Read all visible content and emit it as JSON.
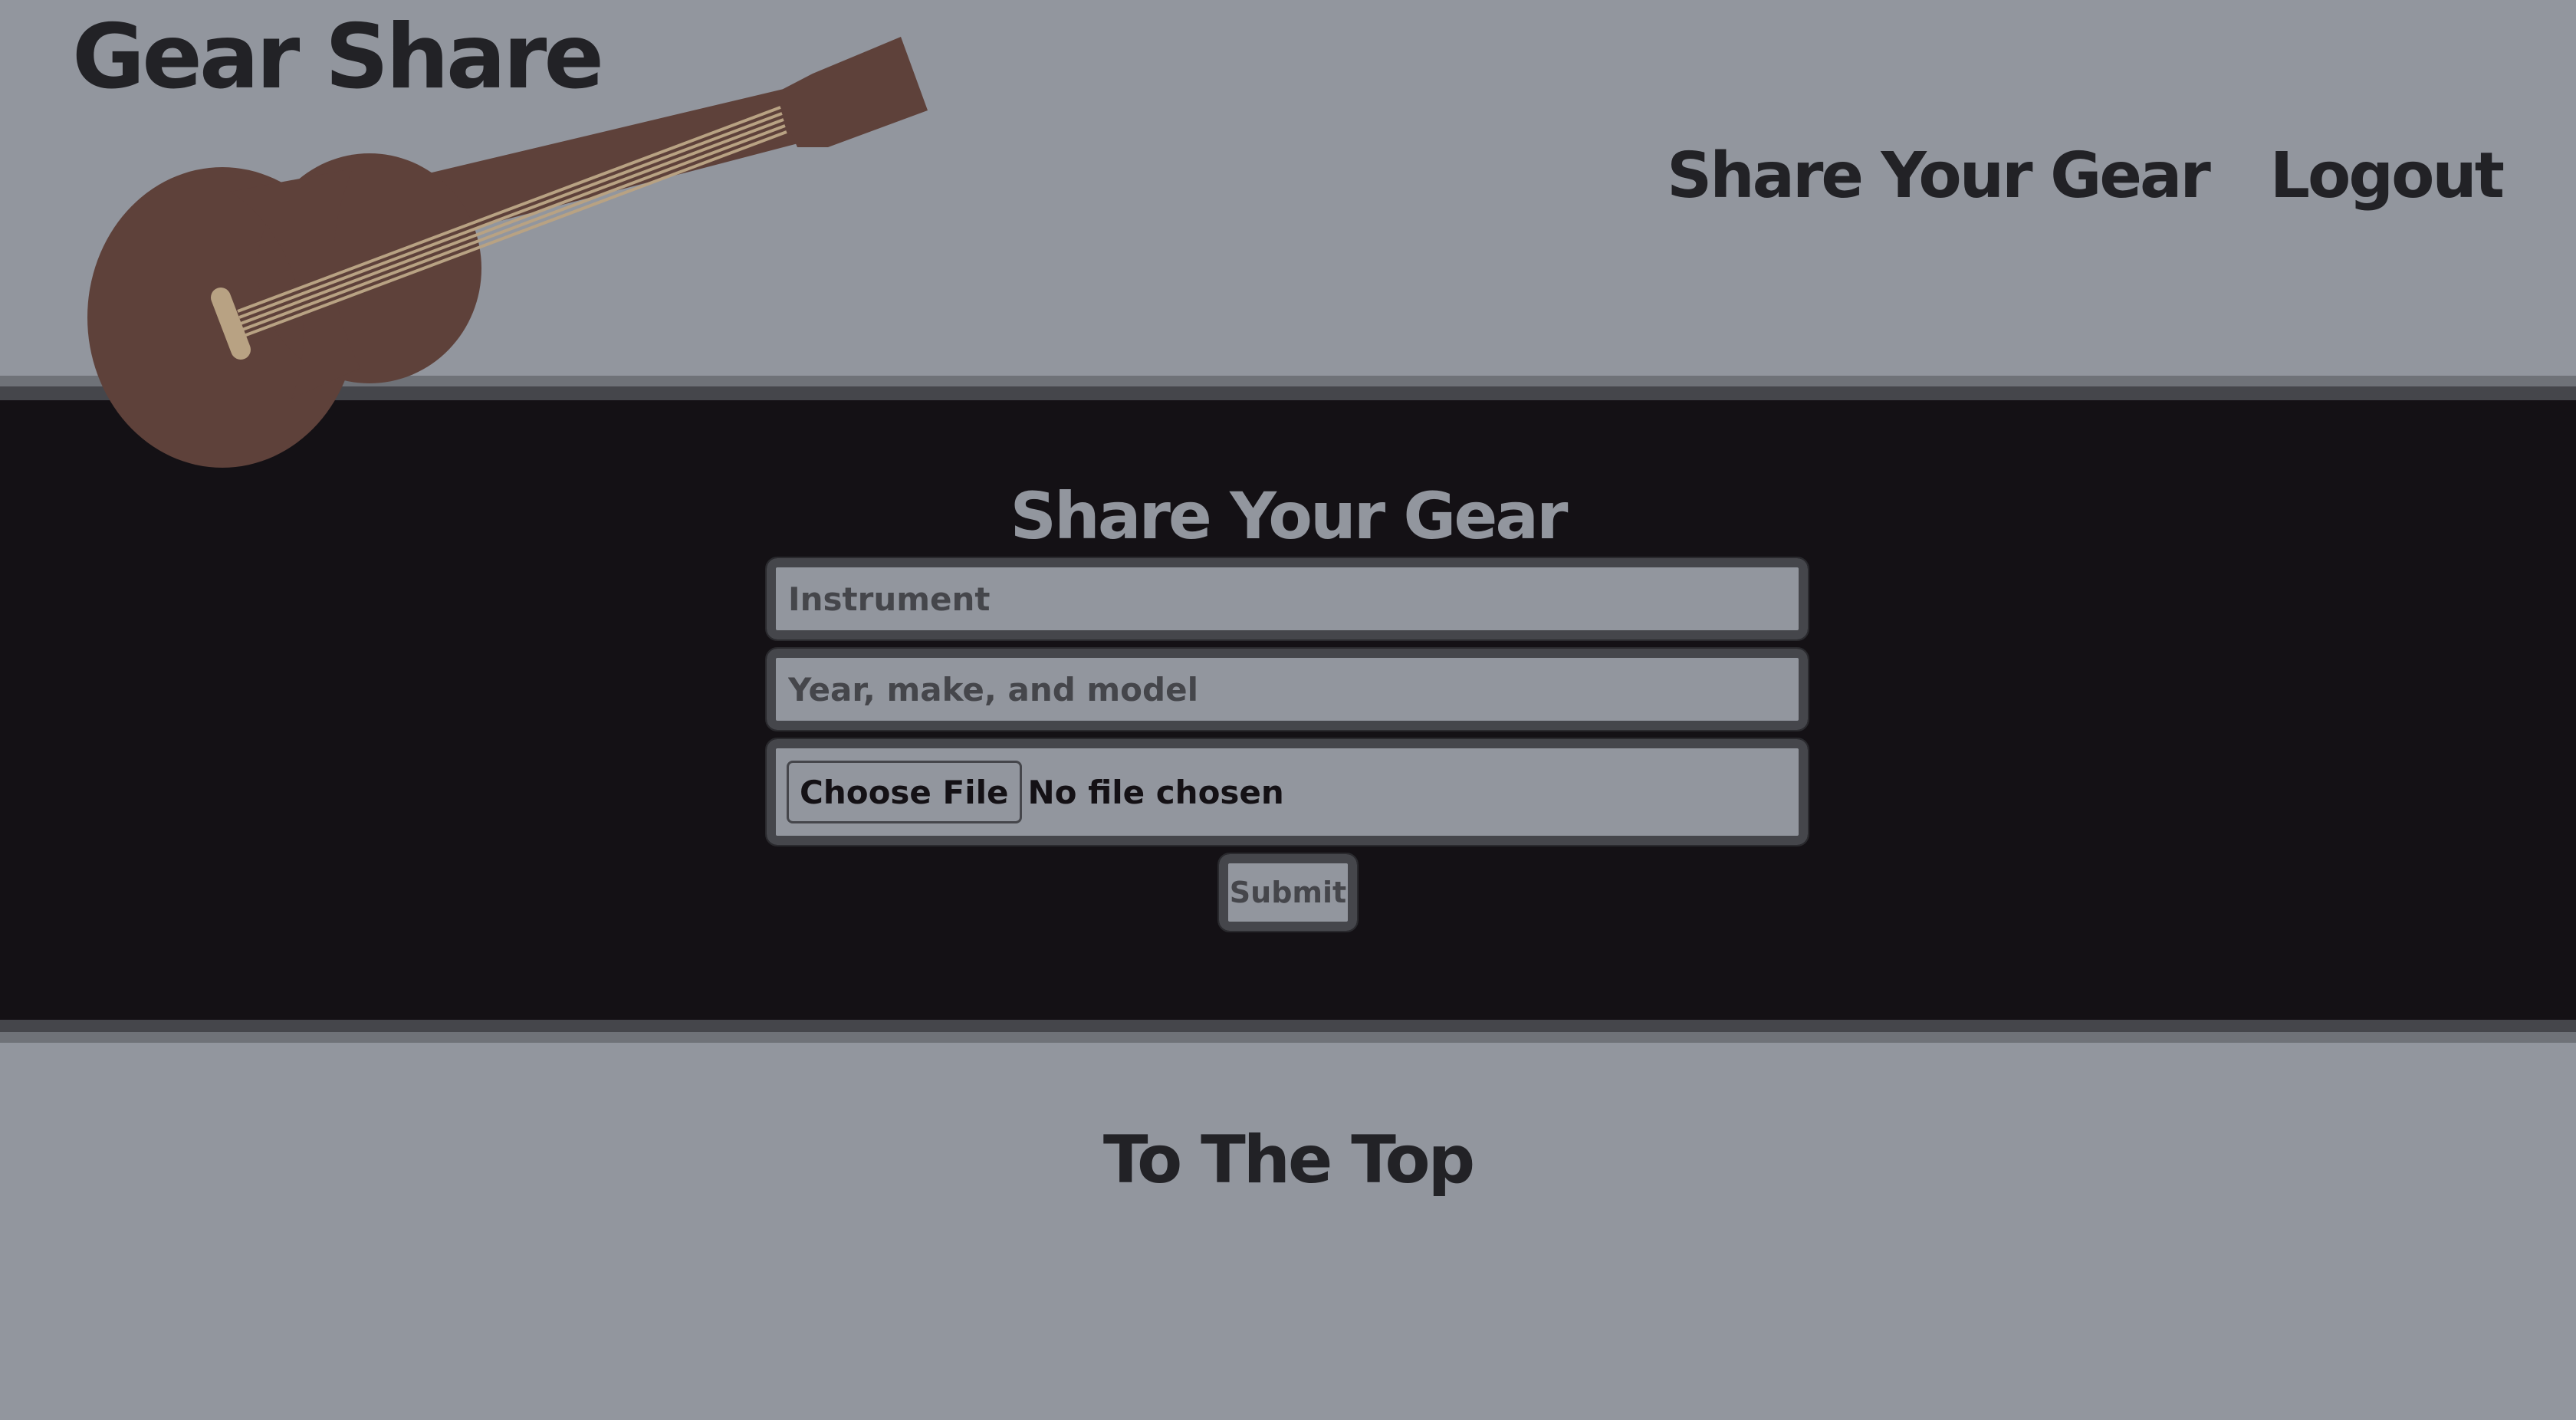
{
  "header": {
    "logo": "Gear Share",
    "nav": {
      "share_label": "Share Your Gear",
      "logout_label": "Logout"
    }
  },
  "main": {
    "title": "Share Your Gear",
    "form": {
      "instrument_placeholder": "Instrument",
      "model_placeholder": "Year, make, and model",
      "file_button_label": "Choose File",
      "file_status": "No file chosen",
      "submit_label": "Submit"
    }
  },
  "footer": {
    "to_top_label": "To The Top"
  },
  "colors": {
    "page_background": "#92969e",
    "main_background": "#141115",
    "text_dark": "#222226",
    "border": "#45464b",
    "guitar_body": "#5e413a",
    "guitar_strings": "#b8a283"
  },
  "icons": {
    "logo_illustration": "acoustic-guitar-icon"
  }
}
